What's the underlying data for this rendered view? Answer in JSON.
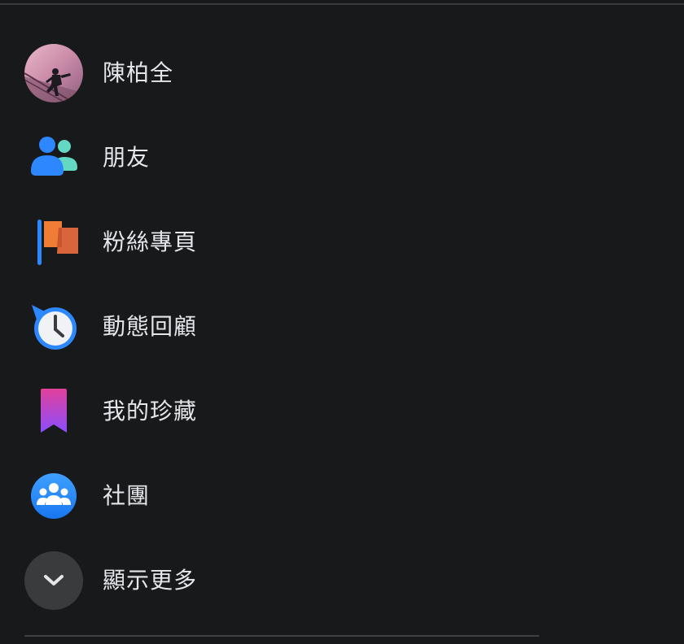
{
  "menu": {
    "items": [
      {
        "label": "陳柏全",
        "icon": "profile-avatar"
      },
      {
        "label": "朋友",
        "icon": "friends-icon"
      },
      {
        "label": "粉絲專頁",
        "icon": "pages-flag-icon"
      },
      {
        "label": "動態回顧",
        "icon": "memories-clock-icon"
      },
      {
        "label": "我的珍藏",
        "icon": "saved-bookmark-icon"
      },
      {
        "label": "社團",
        "icon": "groups-icon"
      },
      {
        "label": "顯示更多",
        "icon": "chevron-down-icon"
      }
    ]
  },
  "colors": {
    "background": "#18191a",
    "text": "#e4e6eb",
    "blue": "#2d88ff",
    "teal": "#63d8c2",
    "orange": "#f07c36",
    "pink_purple": "#d63fa0",
    "more_bg": "#3a3b3c"
  }
}
